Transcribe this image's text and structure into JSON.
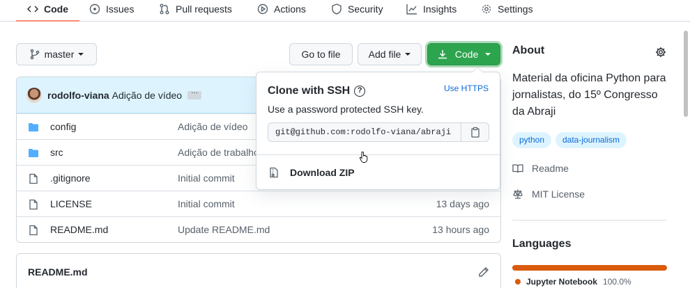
{
  "tabs": [
    {
      "label": "Code",
      "icon": "code-icon"
    },
    {
      "label": "Issues",
      "icon": "issue-icon"
    },
    {
      "label": "Pull requests",
      "icon": "pull-request-icon"
    },
    {
      "label": "Actions",
      "icon": "play-icon"
    },
    {
      "label": "Security",
      "icon": "shield-icon"
    },
    {
      "label": "Insights",
      "icon": "graph-icon"
    },
    {
      "label": "Settings",
      "icon": "gear-icon"
    }
  ],
  "toolbar": {
    "branch_label": "master",
    "go_to_file_label": "Go to file",
    "add_file_label": "Add file",
    "code_label": "Code"
  },
  "commit": {
    "author": "rodolfo-viana",
    "message": "Adição de vídeo",
    "ellipsis": "···"
  },
  "files": [
    {
      "name": "config",
      "type": "folder",
      "message": "Adição de vídeo",
      "time": ""
    },
    {
      "name": "src",
      "type": "folder",
      "message": "Adição de trabalho",
      "time": ""
    },
    {
      "name": ".gitignore",
      "type": "file",
      "message": "Initial commit",
      "time": ""
    },
    {
      "name": "LICENSE",
      "type": "file",
      "message": "Initial commit",
      "time": "13 days ago"
    },
    {
      "name": "README.md",
      "type": "file",
      "message": "Update README.md",
      "time": "13 hours ago"
    }
  ],
  "readme": {
    "title": "README.md"
  },
  "clone": {
    "title": "Clone with SSH",
    "use_https": "Use HTTPS",
    "subtitle": "Use a password protected SSH key.",
    "url": "git@github.com:rodolfo-viana/abraji",
    "download_zip": "Download ZIP"
  },
  "about": {
    "heading": "About",
    "description": "Material da oficina Python para jornalistas, do 15º Congresso da Abraji",
    "topics": [
      "python",
      "data-journalism"
    ],
    "readme_link": "Readme",
    "license_link": "MIT License"
  },
  "languages": {
    "heading": "Languages",
    "items": [
      {
        "name": "Jupyter Notebook",
        "percent": "100.0%",
        "color": "#da5b0b"
      }
    ]
  },
  "colors": {
    "accent_green": "#2da44e",
    "link_blue": "#0969da",
    "tab_underline": "#fd8c73"
  }
}
